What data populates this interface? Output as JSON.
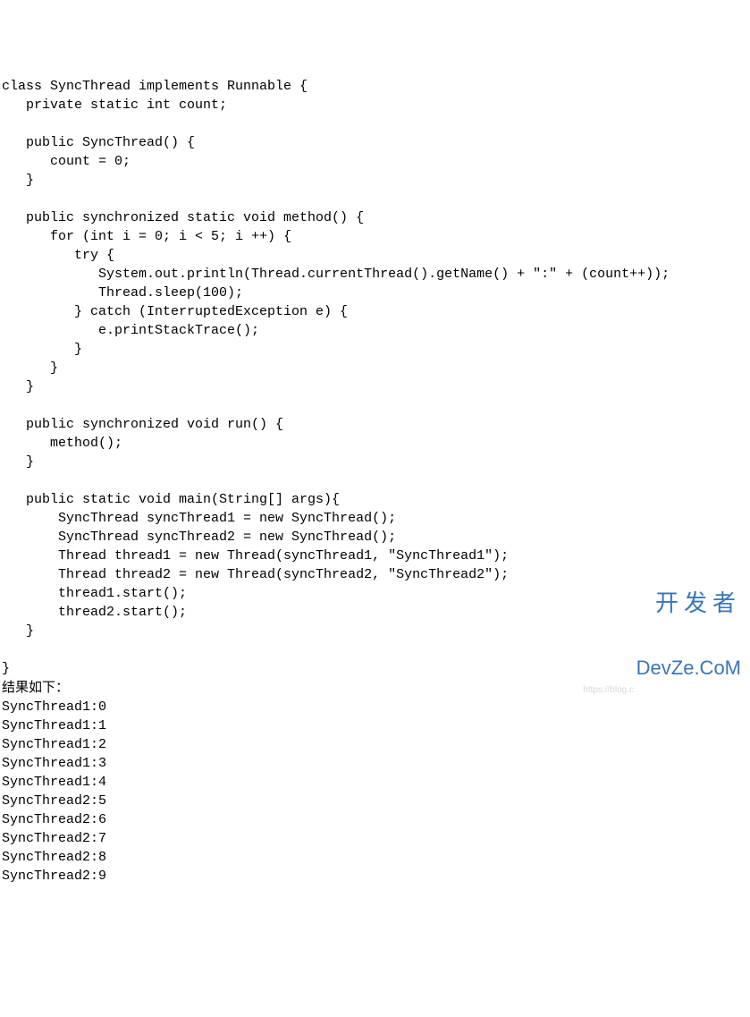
{
  "code": {
    "lines": [
      "class SyncThread implements Runnable {",
      "   private static int count;",
      "",
      "   public SyncThread() {",
      "      count = 0;",
      "   }",
      "",
      "   public synchronized static void method() {",
      "      for (int i = 0; i < 5; i ++) {",
      "         try {",
      "            System.out.println(Thread.currentThread().getName() + \":\" + (count++));",
      "            Thread.sleep(100);",
      "         } catch (InterruptedException e) {",
      "            e.printStackTrace();",
      "         }",
      "      }",
      "   }",
      "",
      "   public synchronized void run() {",
      "      method();",
      "   }",
      "",
      "   public static void main(String[] args){",
      "       SyncThread syncThread1 = new SyncThread();",
      "       SyncThread syncThread2 = new SyncThread();",
      "       Thread thread1 = new Thread(syncThread1, \"SyncThread1\");",
      "       Thread thread2 = new Thread(syncThread2, \"SyncThread2\");",
      "       thread1.start();",
      "       thread2.start();",
      "   }",
      "",
      "}"
    ]
  },
  "result_label": "结果如下：",
  "output": [
    "SyncThread1:0",
    "SyncThread1:1",
    "SyncThread1:2",
    "SyncThread1:3",
    "SyncThread1:4",
    "SyncThread2:5",
    "SyncThread2:6",
    "SyncThread2:7",
    "SyncThread2:8",
    "SyncThread2:9"
  ],
  "watermark": {
    "cn": "开发者",
    "en": "DevZe.CoM",
    "tiny": "https://blog.c"
  }
}
